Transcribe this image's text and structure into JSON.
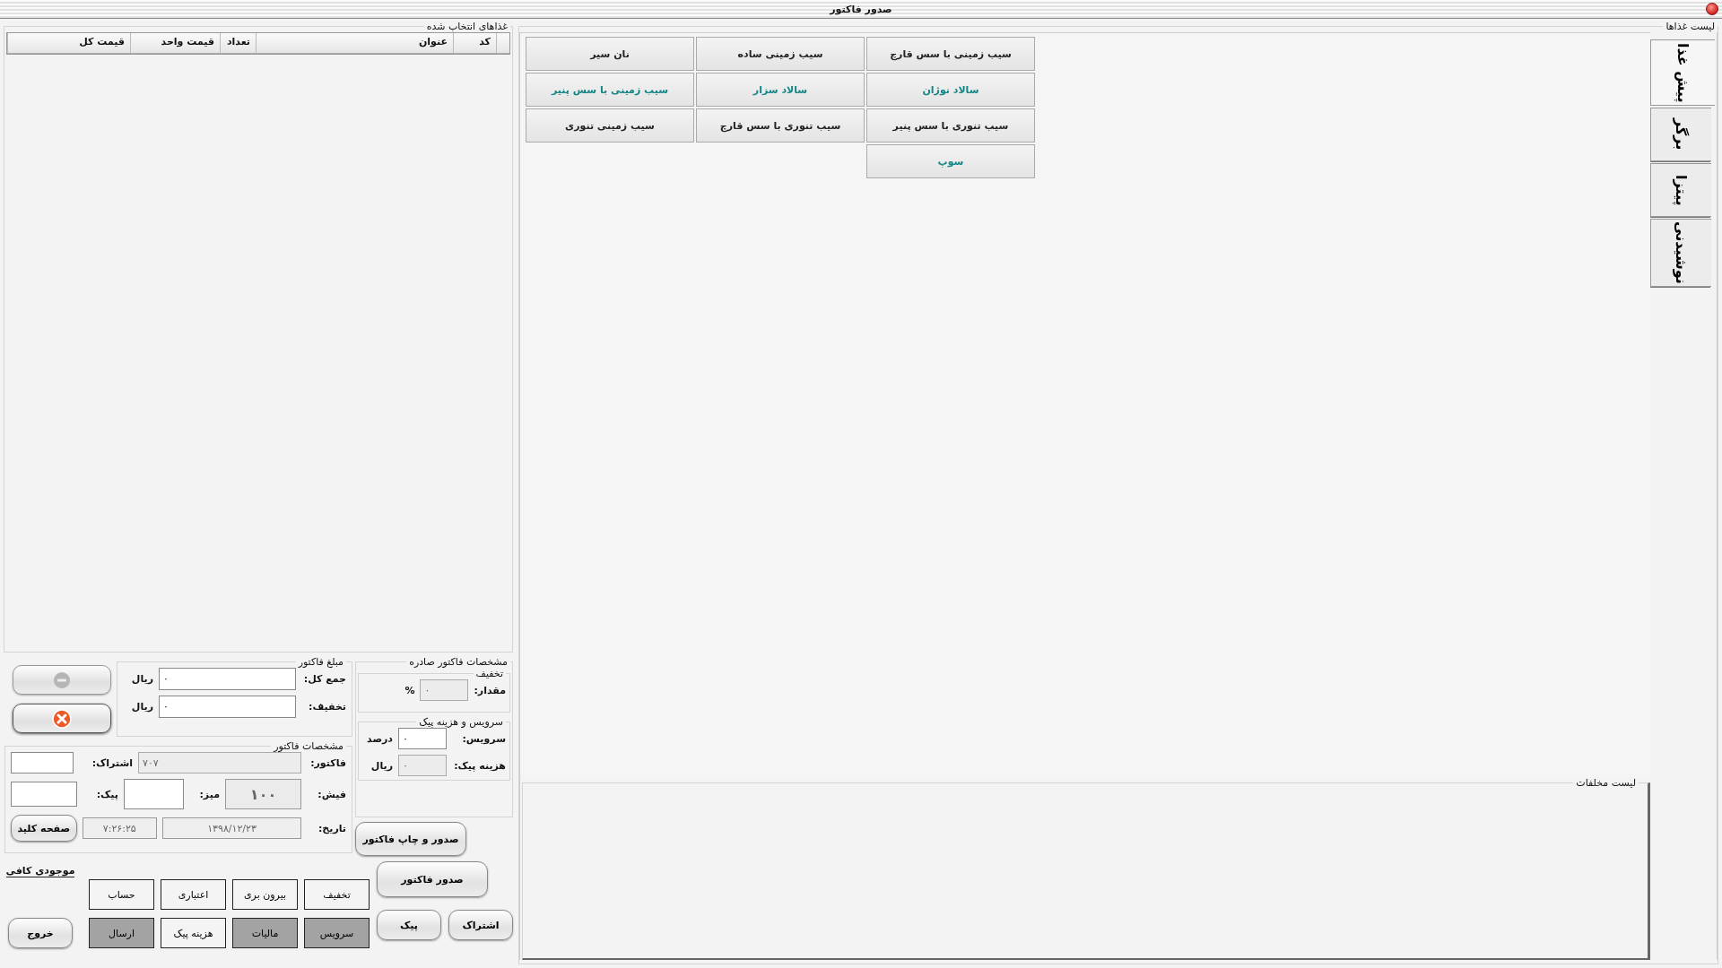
{
  "window": {
    "title": "صدور فاکتور"
  },
  "food_list": {
    "title": "لیست غذاها",
    "tabs": [
      {
        "label": "پیش غذا",
        "selected": true
      },
      {
        "label": "برگر",
        "selected": false
      },
      {
        "label": "پیتزا",
        "selected": false
      },
      {
        "label": "نوشیدنی",
        "selected": false
      }
    ],
    "items": [
      {
        "label": "سیب زمینی با سس قارچ",
        "color": "#222222"
      },
      {
        "label": "سیب زمینی ساده",
        "color": "#222222"
      },
      {
        "label": "نان سیر",
        "color": "#222222"
      },
      {
        "label": "سالاد نوژان",
        "color": "#138585"
      },
      {
        "label": "سالاد سزار",
        "color": "#138585"
      },
      {
        "label": "سیب زمینی با سس پنیر",
        "color": "#138585"
      },
      {
        "label": "سیب تنوری با سس پنیر",
        "color": "#222222"
      },
      {
        "label": "سیب تنوری با سس قارچ",
        "color": "#222222"
      },
      {
        "label": "سیب زمینی تنوری",
        "color": "#222222"
      },
      {
        "label": "سوپ",
        "color": "#138585"
      }
    ]
  },
  "sides": {
    "title": "لیست مخلفات"
  },
  "selected_foods": {
    "title": "غذاهای انتخاب شده",
    "columns": [
      "کد",
      "عنوان",
      "تعداد",
      "قیمت واحد",
      "قیمت کل"
    ]
  },
  "side_buttons": [
    {
      "kind": "minus",
      "disabled": true
    },
    {
      "kind": "cancel",
      "disabled": false
    }
  ],
  "invoice_amount": {
    "title": "مبلغ فاکتور",
    "rows": [
      {
        "label": "جمع کل:",
        "value": "٠",
        "unit": "ریال"
      },
      {
        "label": "تخفیف:",
        "value": "٠",
        "unit": "ریال"
      }
    ]
  },
  "issued_invoice": {
    "title": "مشخصات فاکتور صادره",
    "discount": {
      "title": "تخفیف",
      "label": "مقدار:",
      "value": "٠",
      "unit": "%",
      "disabled": true
    },
    "service": {
      "title": "سرویس و هزینه پیک",
      "rows": [
        {
          "label": "سرویس:",
          "value": "٠",
          "unit": "درصد",
          "disabled": false
        },
        {
          "label": "هزینه پیک:",
          "value": "٠",
          "unit": "ریال",
          "disabled": true
        }
      ]
    }
  },
  "invoice_details": {
    "title": "مشخصات فاکتور",
    "invoice": {
      "label": "فاکتور:",
      "value": "۷۰۷"
    },
    "subscription": {
      "label": "اشتراک:"
    },
    "receipt": {
      "label": "فیش:",
      "value": "۱۰۰"
    },
    "table": {
      "label": "میز:"
    },
    "courier": {
      "label": "پیک:"
    },
    "date": {
      "label": "تاریخ:",
      "value": "۱۳۹۸/۱۲/۲۳"
    },
    "time": "۷:۲۶:۲۵",
    "keyboard_button": "صفحه کلید"
  },
  "print_button": "صدور و چاپ فاکتور",
  "issue_button": "صدور فاکتور",
  "stock_status": "موجودی کافی",
  "bottom_buttons": [
    "اشتراک",
    "پیک"
  ],
  "toggles": [
    {
      "label": "تخفیف",
      "on": false
    },
    {
      "label": "بیرون بری",
      "on": false
    },
    {
      "label": "اعتباری",
      "on": false
    },
    {
      "label": "حساب",
      "on": false
    },
    {
      "label": "سرویس",
      "on": true
    },
    {
      "label": "مالیات",
      "on": true
    },
    {
      "label": "هزینه پیک",
      "on": false
    },
    {
      "label": "ارسال",
      "on": true
    }
  ],
  "exit_button": "خروج"
}
